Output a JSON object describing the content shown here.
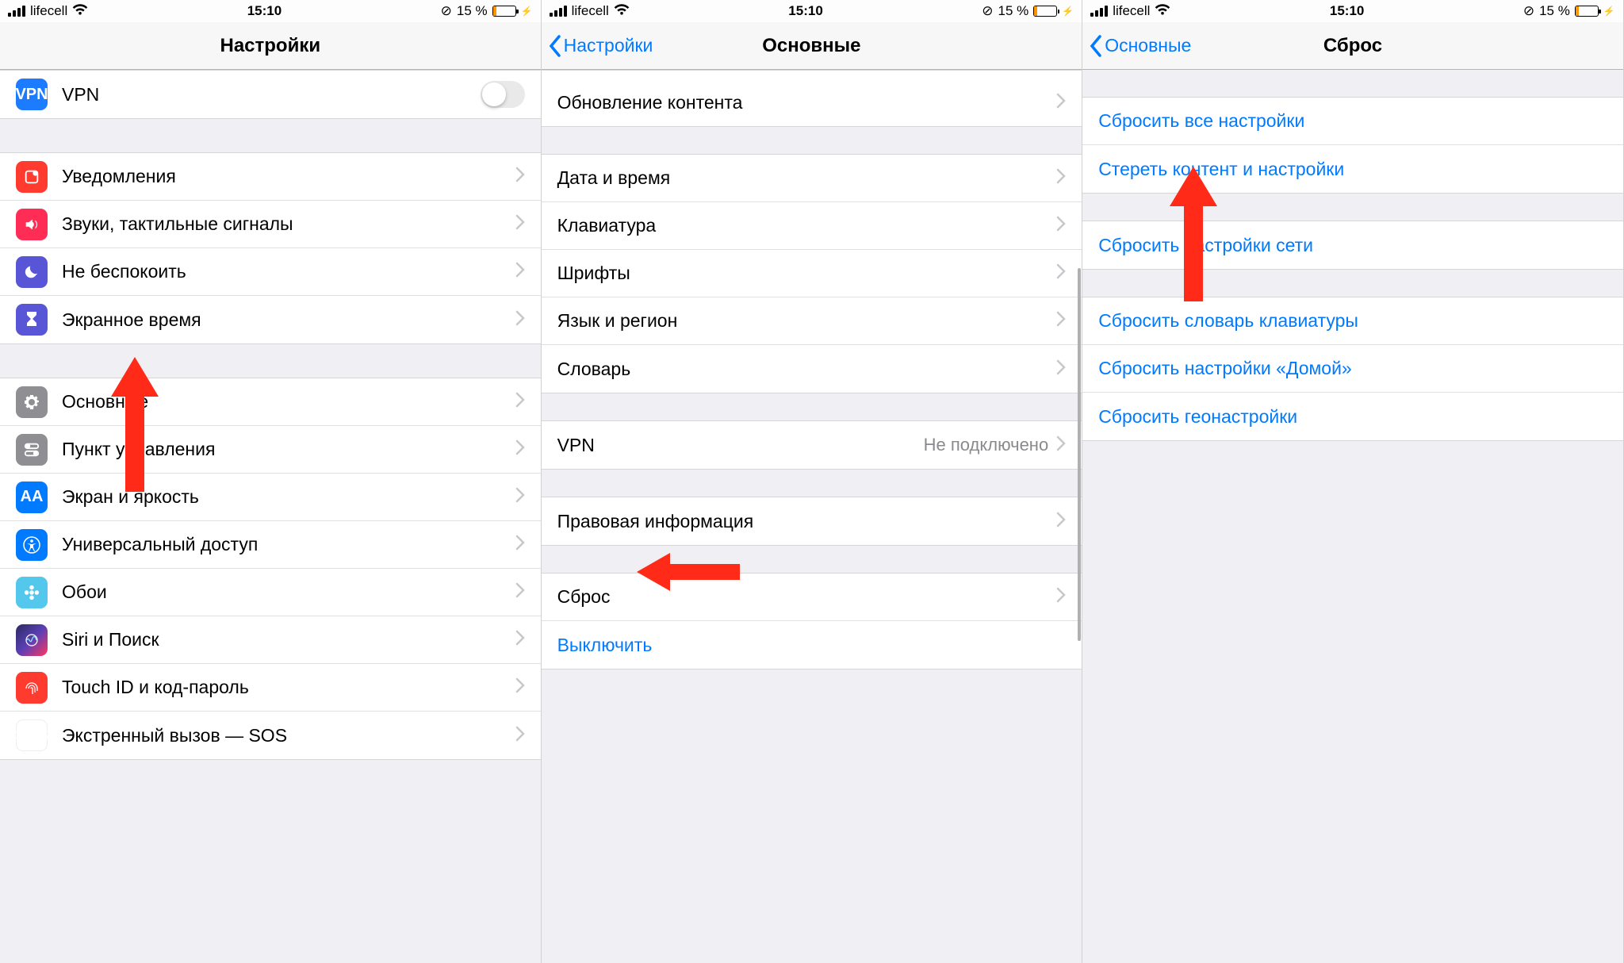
{
  "status": {
    "carrier": "lifecell",
    "time": "15:10",
    "battery_pct": "15 %"
  },
  "screen1": {
    "title": "Настройки",
    "rows": {
      "vpn": "VPN",
      "notifications": "Уведомления",
      "sounds": "Звуки, тактильные сигналы",
      "dnd": "Не беспокоить",
      "screentime": "Экранное время",
      "general": "Основные",
      "control": "Пункт управления",
      "display": "Экран и яркость",
      "accessibility": "Универсальный доступ",
      "wallpaper": "Обои",
      "siri": "Siri и Поиск",
      "touchid": "Touch ID и код-пароль",
      "sos": "Экстренный вызов — SOS"
    }
  },
  "screen2": {
    "back": "Настройки",
    "title": "Основные",
    "rows": {
      "refresh": "Обновление контента",
      "datetime": "Дата и время",
      "keyboard": "Клавиатура",
      "fonts": "Шрифты",
      "language": "Язык и регион",
      "dictionary": "Словарь",
      "vpn_label": "VPN",
      "vpn_value": "Не подключено",
      "legal": "Правовая информация",
      "reset": "Сброс",
      "shutdown": "Выключить"
    }
  },
  "screen3": {
    "back": "Основные",
    "title": "Сброс",
    "rows": {
      "reset_all": "Сбросить все настройки",
      "erase_all": "Стереть контент и настройки",
      "reset_network": "Сбросить настройки сети",
      "reset_keyboard": "Сбросить словарь клавиатуры",
      "reset_home": "Сбросить настройки «Домой»",
      "reset_location": "Сбросить геонастройки"
    }
  }
}
